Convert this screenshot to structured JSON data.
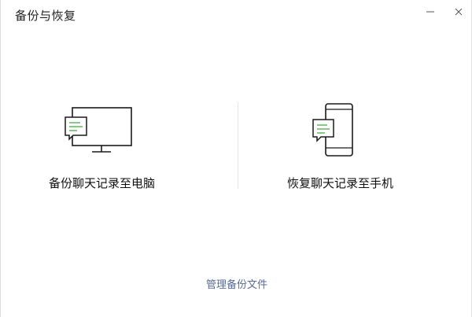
{
  "window": {
    "title": "备份与恢复"
  },
  "controls": {
    "minimize_icon": "minimize-icon",
    "close_icon": "close-icon"
  },
  "options": [
    {
      "label": "备份聊天记录至电脑",
      "icon": "monitor-chat-icon"
    },
    {
      "label": "恢复聊天记录至手机",
      "icon": "phone-chat-icon"
    }
  ],
  "footer": {
    "manage_label": "管理备份文件"
  },
  "colors": {
    "accent_green": "#5fb85f",
    "link_blue": "#576b95",
    "icon_stroke": "#1a1a1a",
    "divider": "#e4e4e4"
  }
}
